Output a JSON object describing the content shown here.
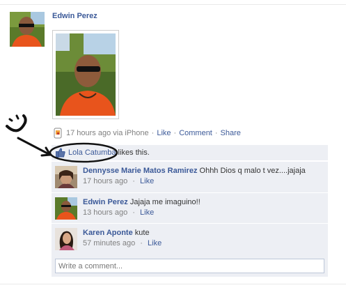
{
  "post": {
    "author": "Edwin Perez",
    "time": "17 hours ago via iPhone",
    "actions": [
      "Like",
      "Comment",
      "Share"
    ],
    "separator": "·"
  },
  "likes": {
    "name": "Lola Catumba",
    "suffix": " likes this."
  },
  "comments": [
    {
      "author": "Dennysse Marie Matos Ramirez",
      "text": "Ohhh Dios q malo t vez....jajaja",
      "time": "17 hours ago",
      "like": "Like"
    },
    {
      "author": "Edwin Perez",
      "text": "Jajaja me imaguino!!",
      "time": "13 hours ago",
      "like": "Like"
    },
    {
      "author": "Karen Aponte",
      "text": "kute",
      "time": "57 minutes ago",
      "like": "Like"
    }
  ],
  "write_comment": {
    "placeholder": "Write a comment..."
  },
  "colors": {
    "link": "#3b5998",
    "panel": "#edeff4",
    "meta": "#808080",
    "shirt": "#e8541c"
  },
  "icons": [
    "thumbs-up-icon",
    "iphone-app-icon",
    "arrow-annotation",
    "smiley-annotation"
  ]
}
